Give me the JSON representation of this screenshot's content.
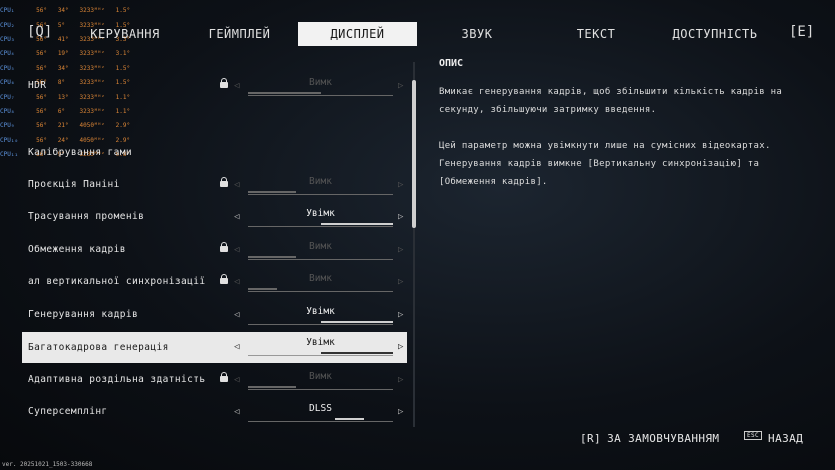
{
  "nav": {
    "left_key": "[Q]",
    "right_key": "[E]",
    "tabs": [
      {
        "label": "КЕРУВАННЯ"
      },
      {
        "label": "ГЕЙМПЛЕЙ"
      },
      {
        "label": "ДИСПЛЕЙ"
      },
      {
        "label": "ЗВУК"
      },
      {
        "label": "ТЕКСТ"
      },
      {
        "label": "ДОСТУПНІСТЬ"
      }
    ]
  },
  "settings_partial": {
    "hdr_label": "HDR",
    "gamma_label": "Калібрування гами"
  },
  "settings": [
    {
      "label": "HDR",
      "value": "Вимк",
      "locked": true,
      "level": 0.5
    },
    {
      "label": "Проєкція Паніні",
      "value": "Вимк",
      "locked": true,
      "level": 0.33
    },
    {
      "label": "Трасування променів",
      "value": "Увімк",
      "locked": false,
      "level": 0.5
    },
    {
      "label": "Обмеження кадрів",
      "value": "Вимк",
      "locked": true,
      "level": 0.33
    },
    {
      "label": "ал вертикальної синхронізації",
      "value": "Вимк",
      "locked": true,
      "level": 0.2
    },
    {
      "label": "Генерування кадрів",
      "value": "Увімк",
      "locked": false,
      "level": 0.5
    },
    {
      "label": "Багатокадрова генерація",
      "value": "Увімк",
      "locked": false,
      "level": 0.5
    },
    {
      "label": "Адаптивна роздільна здатність",
      "value": "Вимк",
      "locked": true,
      "level": 0.33
    },
    {
      "label": "Суперсемплінг",
      "value": "DLSS",
      "locked": false,
      "level": 0.2
    }
  ],
  "description": {
    "title": "ОПИС",
    "p1": "Вмикає генерування кадрів, щоб збільшити кількість кадрів на секунду, збільшуючи затримку введення.",
    "p2": "Цей параметр можна увімкнути лише на сумісних відеокартах.",
    "p3": "Генерування кадрів вимкне [Вертикальну синхронізацію] та [Обмеження кадрів]."
  },
  "footer": {
    "default_key": "[R]",
    "default_label": "ЗА ЗАМОВЧУВАННЯМ",
    "back_key": "ESC",
    "back_label": "НАЗАД",
    "version": "ver. 20251021_1503-330668"
  },
  "colors": {
    "accent": "#f2f2f2",
    "selected_row": "#e9e9e9",
    "overlay_blue": "#6aa9ff",
    "overlay_orange": "#ff9a3c"
  }
}
